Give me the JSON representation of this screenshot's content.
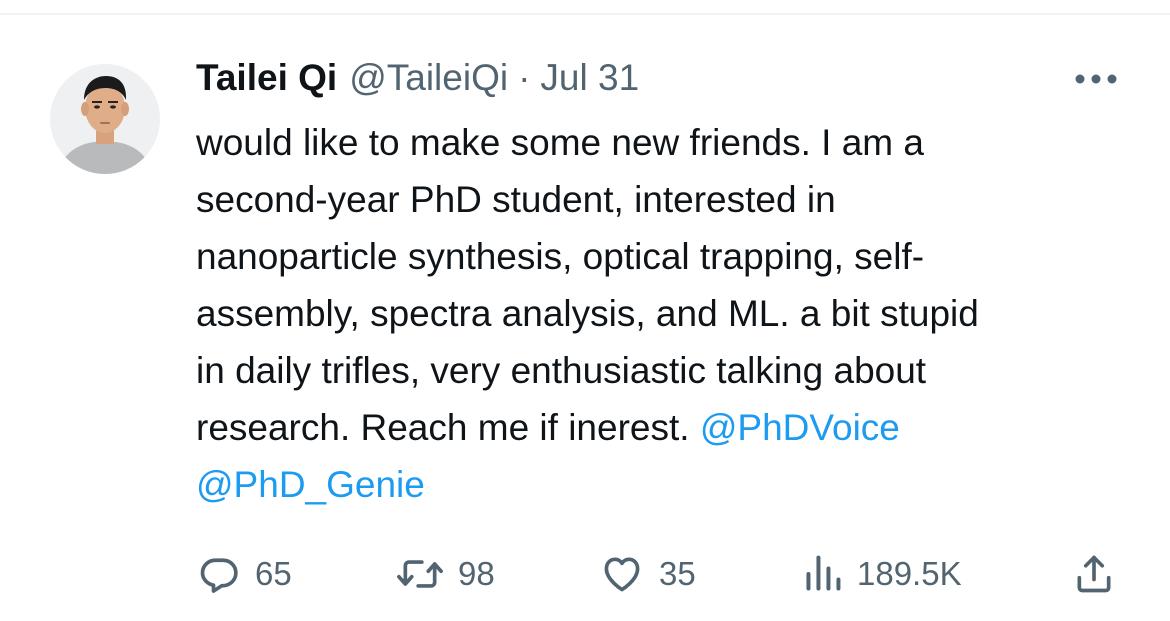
{
  "tweet": {
    "author": {
      "display_name": "Tailei Qi",
      "handle": "@TaileiQi",
      "separator": "·",
      "date": "Jul 31"
    },
    "body_lines": [
      "would like to make some new friends. I am a",
      "second-year PhD student, interested in",
      "nanoparticle synthesis, optical trapping, self-",
      "assembly, spectra analysis, and ML. a bit stupid",
      "in daily trifles, very enthusiastic talking about"
    ],
    "body_last_line_text": "research. Reach me if inerest.",
    "mentions": [
      "@PhDVoice",
      "@PhD_Genie"
    ],
    "stats": {
      "replies": "65",
      "retweets": "98",
      "likes": "35",
      "views": "189.5K"
    },
    "icons": {
      "more": "more-horizontal-icon",
      "reply": "reply-icon",
      "retweet": "retweet-icon",
      "like": "heart-icon",
      "views": "views-chart-icon",
      "share": "share-icon"
    },
    "colors": {
      "text": "#0f1419",
      "secondary": "#536471",
      "link": "#1d9bf0",
      "divider": "#eff3f4"
    }
  }
}
